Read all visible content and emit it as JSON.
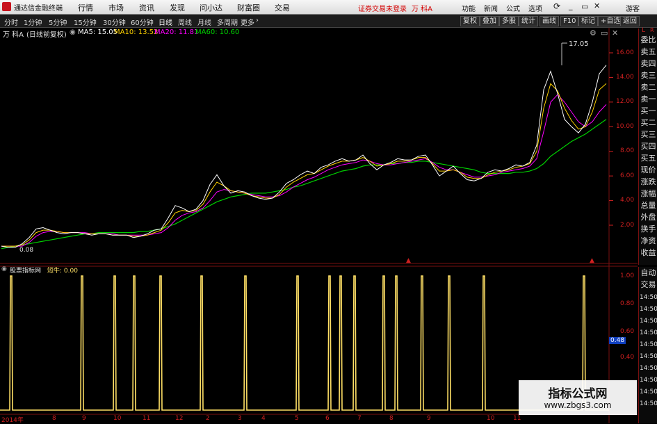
{
  "menubar": {
    "app_title": "通达信金融终端",
    "menus": [
      "行情",
      "市场",
      "资讯",
      "发现",
      "问小达",
      "财富圈",
      "交易"
    ],
    "login_status": "证券交易未登录",
    "stock_name": "万 科A",
    "right_items": [
      "功能",
      "新闻",
      "公式",
      "选项"
    ],
    "guest": "游客"
  },
  "toolbar": {
    "periods": [
      "分时",
      "1分钟",
      "5分钟",
      "15分钟",
      "30分钟",
      "60分钟",
      "日线",
      "周线",
      "月线",
      "多周期",
      "更多"
    ],
    "active_period": "日线",
    "right_buttons": [
      "复权",
      "叠加",
      "多股",
      "统计",
      "画线",
      "F10",
      "标记",
      "+自选",
      "返回"
    ]
  },
  "legend": {
    "stock": "万 科A",
    "mode": "(日线前复权)",
    "ma5": "MA5: 15.05",
    "ma10": "MA10: 13.52",
    "ma20": "MA20: 11.81",
    "ma60": "MA60: 10.60"
  },
  "side_panel": {
    "top_labels": [
      "L",
      "R"
    ],
    "items": [
      "委比",
      "卖五",
      "卖四",
      "卖三",
      "卖二",
      "卖一",
      "买一",
      "买二",
      "买三",
      "买四",
      "买五",
      "现价",
      "涨跌",
      "涨幅",
      "总量",
      "外盘",
      "换手",
      "净资",
      "收益"
    ],
    "lower_items": [
      "自动",
      "交易",
      "14:50",
      "14:50",
      "14:50",
      "14:50",
      "14:50",
      "14:50",
      "14:50",
      "14:50",
      "14:50",
      "14:50"
    ]
  },
  "price_axis": {
    "ticks": [
      "16.00",
      "14.00",
      "12.00",
      "10.00",
      "8.00",
      "6.00",
      "4.00",
      "2.00"
    ]
  },
  "indicator_axis": {
    "ticks": [
      "1.00",
      "0.80",
      "0.60",
      "0.40"
    ],
    "current_value": "0.48"
  },
  "sub_chart": {
    "title": "股票指标网",
    "indicator": "短牛: 0.00"
  },
  "x_axis": {
    "labels": [
      "2014年",
      "8",
      "9",
      "10",
      "11",
      "12",
      "2",
      "3",
      "4",
      "5",
      "6",
      "7",
      "8",
      "9",
      "10",
      "11"
    ]
  },
  "annotations": {
    "high": "17.05",
    "low": "0.08"
  },
  "watermark": {
    "title": "指标公式网",
    "url": "www.zbgs3.com"
  },
  "chart_data": [
    {
      "type": "line",
      "title": "万 科A (日线前复权)",
      "ylim": [
        0,
        17.5
      ],
      "x": [
        0,
        10,
        20,
        30,
        40,
        50,
        60,
        70,
        80,
        90,
        100,
        110,
        120,
        130,
        140,
        150,
        160,
        170,
        180,
        190,
        200,
        210,
        220,
        230,
        240,
        250,
        260,
        270,
        280,
        290,
        300,
        310,
        320,
        330,
        340,
        350,
        360,
        370,
        380,
        390,
        400,
        410,
        420,
        430,
        440,
        450,
        460,
        470,
        480,
        490,
        500,
        510,
        520,
        530,
        540,
        550,
        560,
        570,
        580,
        590,
        600,
        610,
        620,
        630,
        640,
        650,
        660,
        670,
        680,
        690,
        700,
        710,
        720,
        730,
        740,
        750,
        760,
        770,
        780,
        790,
        800,
        810,
        820,
        830,
        840,
        850,
        860,
        870
      ],
      "series": [
        {
          "name": "MA5",
          "color": "#ffffff",
          "values": [
            0.3,
            0.2,
            0.2,
            0.5,
            1.0,
            1.7,
            1.8,
            1.6,
            1.4,
            1.3,
            1.4,
            1.4,
            1.3,
            1.2,
            1.3,
            1.3,
            1.2,
            1.2,
            1.2,
            1.0,
            1.1,
            1.3,
            1.6,
            1.7,
            2.6,
            3.6,
            3.4,
            3.1,
            3.3,
            4.0,
            5.3,
            6.1,
            5.2,
            4.6,
            4.8,
            4.7,
            4.4,
            4.2,
            4.1,
            4.2,
            4.7,
            5.4,
            5.7,
            6.1,
            6.4,
            6.2,
            6.7,
            6.9,
            7.2,
            7.4,
            7.2,
            7.3,
            7.7,
            7.0,
            6.5,
            6.9,
            7.1,
            7.4,
            7.3,
            7.3,
            7.6,
            7.7,
            6.9,
            6.0,
            6.4,
            6.8,
            6.2,
            5.7,
            5.6,
            5.8,
            6.3,
            6.5,
            6.4,
            6.6,
            6.9,
            6.8,
            7.1,
            8.5,
            13.0,
            14.5,
            12.7,
            10.6,
            10.0,
            9.5,
            10.2,
            12.0,
            14.3,
            15.0
          ]
        },
        {
          "name": "MA10",
          "color": "#ffd200",
          "values": [
            0.3,
            0.3,
            0.3,
            0.4,
            0.8,
            1.4,
            1.6,
            1.6,
            1.5,
            1.4,
            1.4,
            1.4,
            1.3,
            1.3,
            1.3,
            1.3,
            1.2,
            1.2,
            1.2,
            1.1,
            1.1,
            1.2,
            1.4,
            1.6,
            2.2,
            3.0,
            3.2,
            3.1,
            3.2,
            3.7,
            4.7,
            5.5,
            5.2,
            4.8,
            4.7,
            4.6,
            4.4,
            4.3,
            4.2,
            4.2,
            4.5,
            5.1,
            5.5,
            5.8,
            6.1,
            6.2,
            6.5,
            6.8,
            7.0,
            7.2,
            7.2,
            7.3,
            7.5,
            7.2,
            6.8,
            6.9,
            7.0,
            7.2,
            7.2,
            7.3,
            7.5,
            7.5,
            7.0,
            6.4,
            6.4,
            6.5,
            6.3,
            5.9,
            5.8,
            5.8,
            6.1,
            6.3,
            6.4,
            6.5,
            6.7,
            6.8,
            7.0,
            8.0,
            11.5,
            13.5,
            12.9,
            11.5,
            10.5,
            9.8,
            10.0,
            11.2,
            13.0,
            13.5
          ]
        },
        {
          "name": "MA20",
          "color": "#ff00ff",
          "values": [
            0.3,
            0.3,
            0.3,
            0.3,
            0.6,
            1.1,
            1.4,
            1.5,
            1.5,
            1.4,
            1.4,
            1.4,
            1.4,
            1.3,
            1.3,
            1.3,
            1.3,
            1.2,
            1.2,
            1.2,
            1.2,
            1.2,
            1.3,
            1.4,
            1.8,
            2.4,
            2.8,
            3.0,
            3.1,
            3.4,
            4.0,
            4.7,
            4.9,
            4.8,
            4.7,
            4.6,
            4.5,
            4.4,
            4.3,
            4.3,
            4.4,
            4.7,
            5.1,
            5.4,
            5.7,
            5.9,
            6.2,
            6.5,
            6.7,
            6.9,
            7.0,
            7.1,
            7.3,
            7.2,
            7.0,
            6.9,
            6.9,
            7.0,
            7.1,
            7.2,
            7.3,
            7.4,
            7.1,
            6.7,
            6.5,
            6.5,
            6.3,
            6.1,
            5.9,
            5.9,
            6.0,
            6.1,
            6.3,
            6.4,
            6.5,
            6.6,
            6.8,
            7.4,
            9.6,
            12.0,
            12.6,
            12.0,
            11.2,
            10.4,
            10.0,
            10.4,
            11.2,
            11.8
          ]
        },
        {
          "name": "MA60",
          "color": "#00d000",
          "values": [
            0.1,
            0.2,
            0.3,
            0.4,
            0.5,
            0.6,
            0.7,
            0.8,
            0.9,
            1.0,
            1.1,
            1.2,
            1.3,
            1.3,
            1.4,
            1.4,
            1.4,
            1.4,
            1.4,
            1.4,
            1.5,
            1.5,
            1.6,
            1.7,
            1.9,
            2.1,
            2.4,
            2.7,
            3.0,
            3.3,
            3.6,
            3.9,
            4.1,
            4.3,
            4.4,
            4.5,
            4.6,
            4.6,
            4.6,
            4.7,
            4.8,
            4.9,
            5.1,
            5.2,
            5.4,
            5.6,
            5.8,
            6.0,
            6.2,
            6.4,
            6.5,
            6.6,
            6.8,
            6.9,
            6.9,
            6.9,
            7.0,
            7.0,
            7.1,
            7.1,
            7.2,
            7.2,
            7.1,
            7.0,
            6.9,
            6.8,
            6.7,
            6.6,
            6.5,
            6.3,
            6.2,
            6.2,
            6.2,
            6.2,
            6.3,
            6.3,
            6.4,
            6.6,
            7.0,
            7.6,
            8.0,
            8.4,
            8.8,
            9.1,
            9.4,
            9.8,
            10.2,
            10.6
          ]
        }
      ]
    },
    {
      "type": "line",
      "title": "短牛",
      "ylim": [
        0,
        1.0
      ],
      "series": [
        {
          "name": "短牛",
          "color": "#ffe066",
          "spikes_at": [
            16,
            118,
            165,
            193,
            231,
            290,
            353,
            428,
            474,
            490,
            510,
            552,
            570,
            607,
            646,
            696,
            840
          ],
          "values": [
            1,
            1,
            1,
            1,
            1,
            1,
            1,
            1,
            1,
            1,
            1,
            1,
            1,
            1,
            1,
            1,
            1
          ]
        }
      ]
    }
  ]
}
